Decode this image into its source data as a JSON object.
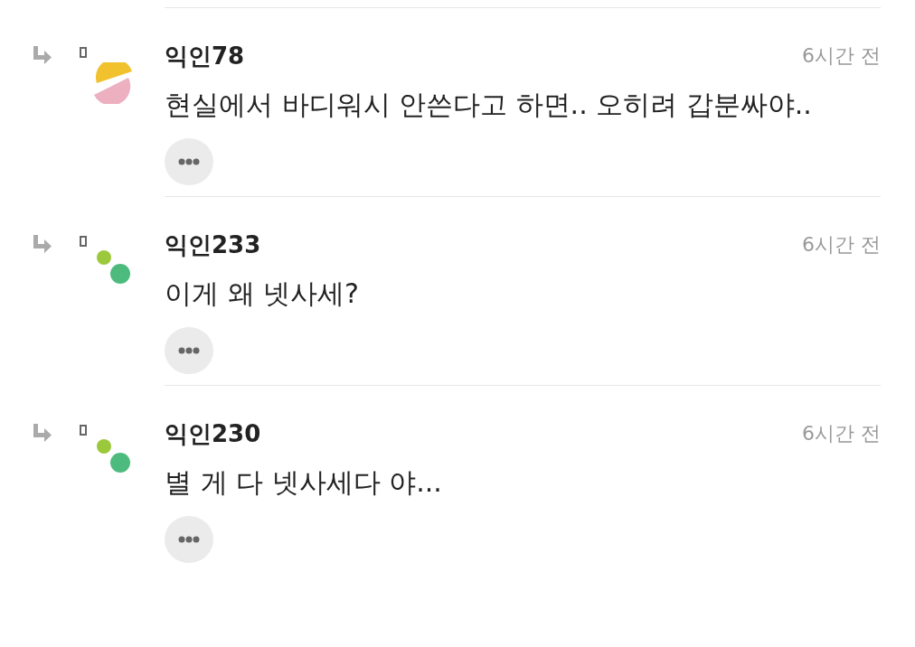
{
  "comments": [
    {
      "author": "익인78",
      "time": "6시간 전",
      "text": "현실에서 바디워시 안쓴다고 하면.. 오히려 갑분싸야..",
      "avatar": {
        "kind": "halves"
      }
    },
    {
      "author": "익인233",
      "time": "6시간 전",
      "text": "이게 왜 넷사세?",
      "avatar": {
        "kind": "dots"
      }
    },
    {
      "author": "익인230",
      "time": "6시간 전",
      "text": "별 게 다 넷사세다 야...",
      "avatar": {
        "kind": "dots"
      }
    }
  ]
}
